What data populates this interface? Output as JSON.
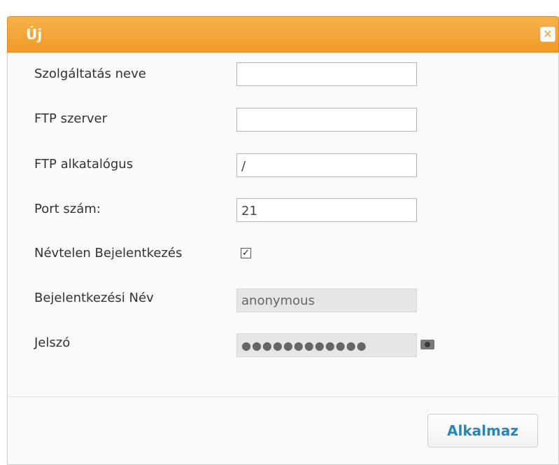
{
  "dialog": {
    "title": "Új",
    "close_icon": "close-icon",
    "apply_label": "Alkalmaz"
  },
  "form": {
    "service_name": {
      "label": "Szolgáltatás neve",
      "value": ""
    },
    "ftp_server": {
      "label": "FTP szerver",
      "value": ""
    },
    "ftp_subdir": {
      "label": "FTP alkatalógus",
      "value": "/"
    },
    "port": {
      "label": "Port szám:",
      "value": "21"
    },
    "anonymous_login": {
      "label": "Névtelen Bejelentkezés",
      "checked": true
    },
    "login_name": {
      "label": "Bejelentkezési Név",
      "value": "anonymous"
    },
    "password": {
      "label": "Jelszó",
      "value": "●●●●●●●●●●●●",
      "reveal_icon": "eye-icon"
    }
  },
  "colors": {
    "title_bar": "#ef9b28",
    "apply_text": "#2a86b8"
  }
}
